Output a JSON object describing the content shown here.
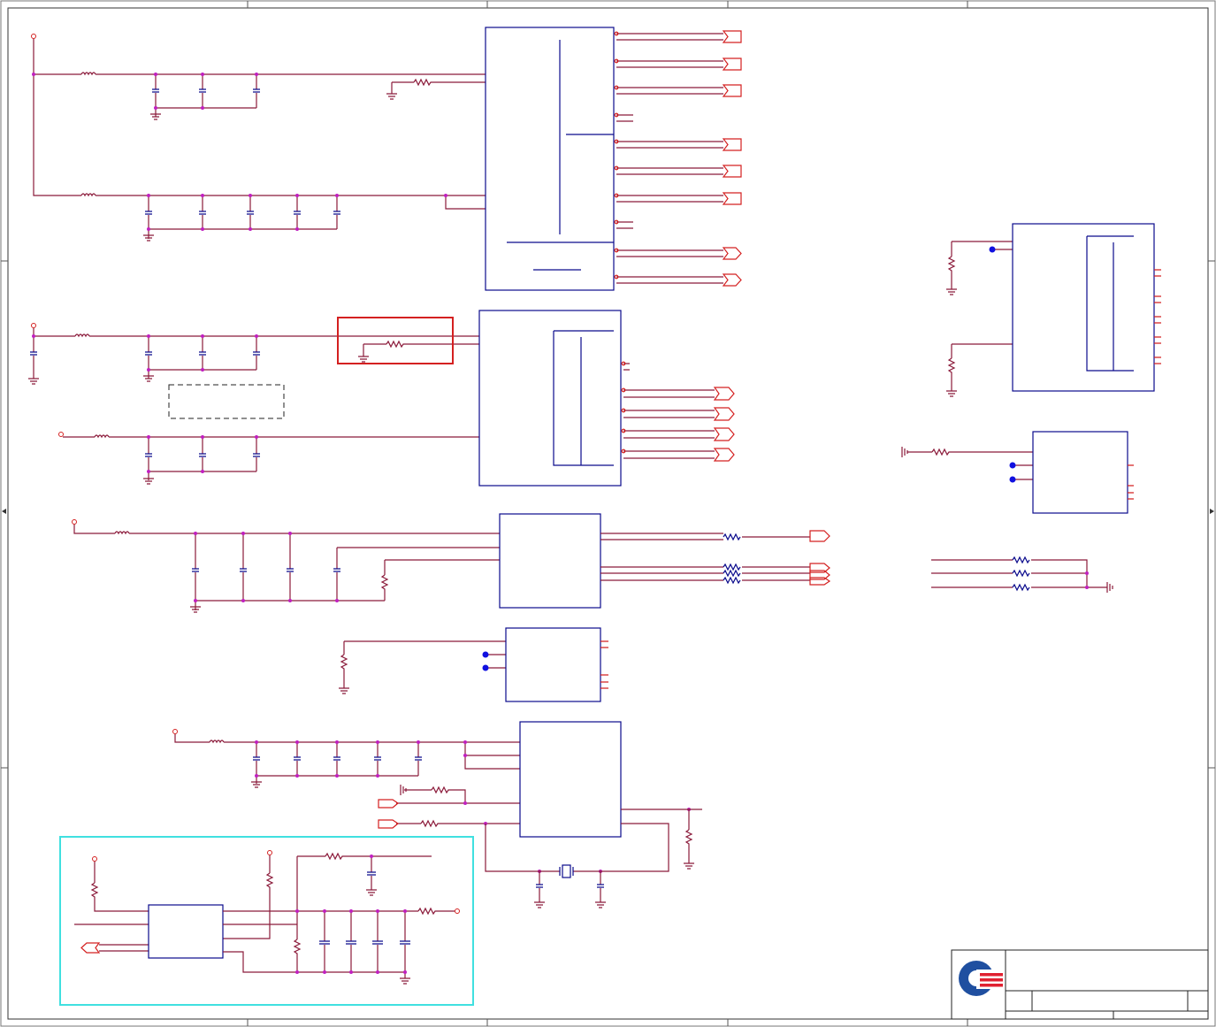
{
  "title_block": {
    "logo": "company-logo"
  },
  "colors": {
    "wire": "#8b1a3a",
    "component": "#0a0a8c",
    "net_label": "#d42020",
    "junction": "#c020c0",
    "highlight": "#d42020",
    "group_box": "#40e0e0",
    "logo_blue": "#1f4fa0",
    "logo_red": "#e02030"
  }
}
